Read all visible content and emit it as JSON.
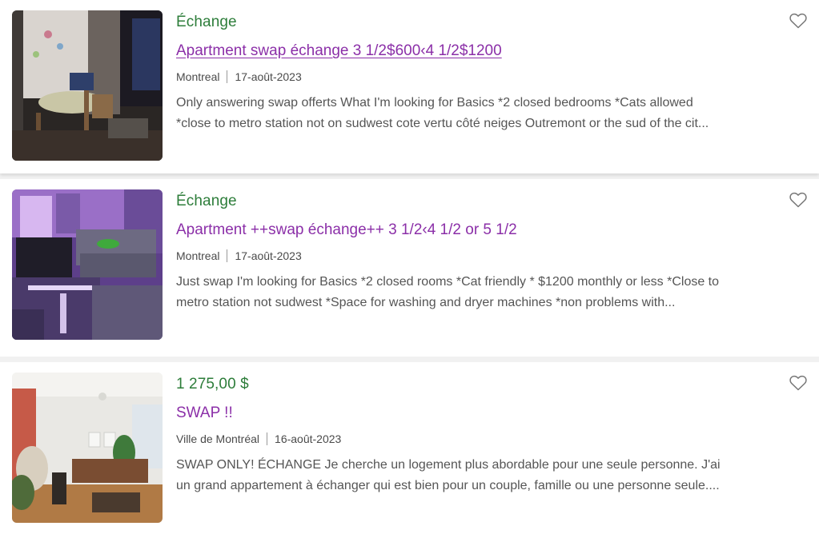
{
  "listings": [
    {
      "price": "Échange",
      "title": "Apartment swap échange 3 1/2$600‹4 1/2$1200",
      "location": "Montreal",
      "date": "17-août-2023",
      "desc_line1": "Only answering swap offerts What I'm looking for Basics *2 closed bedrooms *Cats allowed",
      "desc_line2": "*close to metro station not on sudwest cote vertu côté neiges Outremont or the sud of the cit...",
      "visited": true,
      "thumb_icon": "bedroom-photo"
    },
    {
      "price": "Échange",
      "title": "Apartment ++swap échange++ 3 1/2‹4 1/2 or 5 1/2",
      "location": "Montreal",
      "date": "17-août-2023",
      "desc_line1": "Just swap I'm looking for Basics *2 closed rooms *Cat friendly * $1200 monthly or less *Close to",
      "desc_line2": "metro station not sudwest *Space for washing and dryer machines *non problems with...",
      "visited": false,
      "thumb_icon": "living-room-purple-photo"
    },
    {
      "price": "1 275,00 $",
      "title": "SWAP !!",
      "location": "Ville de Montréal",
      "date": "16-août-2023",
      "desc_line1": "SWAP ONLY! ÉCHANGE Je cherche un logement plus abordable pour une seule personne. J'ai",
      "desc_line2": "un grand appartement à échanger qui est bien pour un couple, famille ou une personne seule....",
      "visited": false,
      "thumb_icon": "living-room-bright-photo"
    }
  ],
  "colors": {
    "price": "#2d7d3a",
    "title": "#8b2fa8",
    "meta": "#4a4a4a",
    "desc": "#555555",
    "heart": "#777777"
  }
}
